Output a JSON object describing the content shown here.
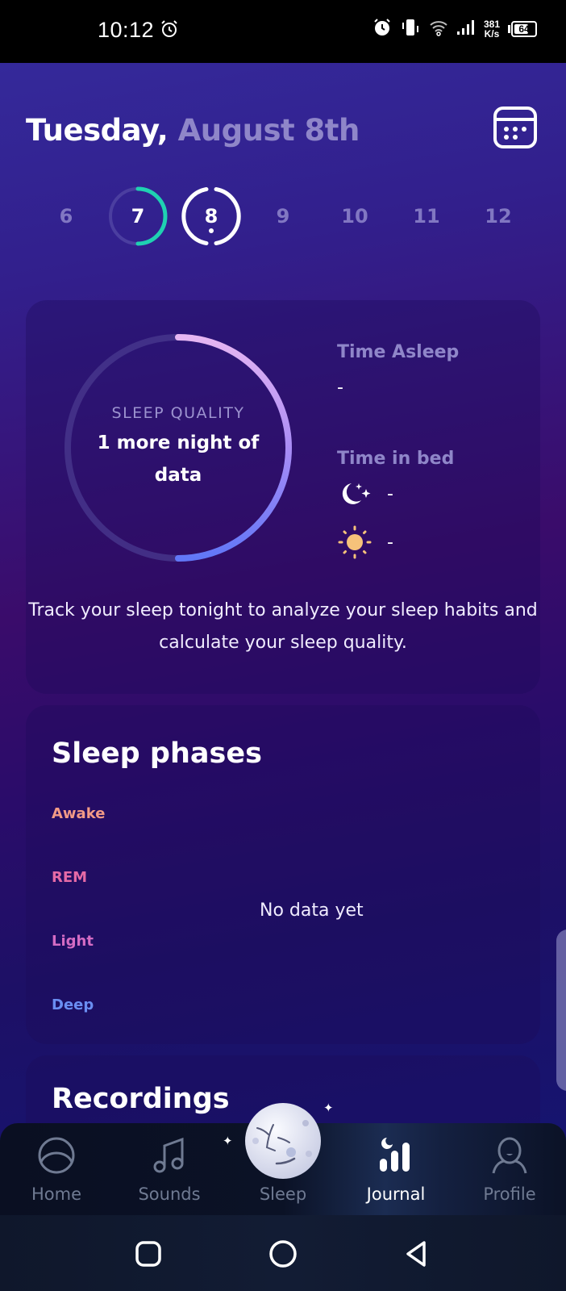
{
  "status_bar": {
    "time": "10:12",
    "network_speed_value": "381",
    "network_speed_unit": "K/s",
    "battery_level": "64",
    "battery_percent": 64,
    "icons": [
      "alarm-icon",
      "alarm-clock-icon",
      "vibrate-icon",
      "wifi-icon",
      "signal-icon",
      "battery-icon"
    ]
  },
  "header": {
    "weekday": "Tuesday,",
    "date": "August 8th",
    "calendar_button": "calendar-icon"
  },
  "day_strip": {
    "days": [
      {
        "label": "6",
        "state": "future-dim"
      },
      {
        "label": "7",
        "state": "done",
        "progress": 0.5
      },
      {
        "label": "8",
        "state": "selected"
      },
      {
        "label": "9",
        "state": "dim"
      },
      {
        "label": "10",
        "state": "dim"
      },
      {
        "label": "11",
        "state": "dim"
      },
      {
        "label": "12",
        "state": "dim"
      }
    ],
    "accent_color": "#1fd1b2"
  },
  "sleep_quality": {
    "label": "SLEEP QUALITY",
    "value": "1 more night of data",
    "progress": 0.5,
    "description": "Track your sleep tonight to analyze your sleep habits and calculate your sleep quality."
  },
  "time_asleep": {
    "title": "Time Asleep",
    "value": "-"
  },
  "time_in_bed": {
    "title": "Time in bed",
    "bedtime": "-",
    "wakeup": "-"
  },
  "sleep_phases": {
    "title": "Sleep phases",
    "phases": [
      {
        "label": "Awake",
        "color": "#f29a86"
      },
      {
        "label": "REM",
        "color": "#e56aa6"
      },
      {
        "label": "Light",
        "color": "#d46cc4"
      },
      {
        "label": "Deep",
        "color": "#6a8ef2"
      }
    ],
    "empty_message": "No data yet"
  },
  "recordings": {
    "title": "Recordings"
  },
  "bottom_nav": {
    "items": [
      {
        "label": "Home",
        "icon": "home-icon",
        "active": false
      },
      {
        "label": "Sounds",
        "icon": "music-note-icon",
        "active": false
      },
      {
        "label": "Sleep",
        "icon": "moon-face-icon",
        "active": false
      },
      {
        "label": "Journal",
        "icon": "journal-chart-icon",
        "active": true
      },
      {
        "label": "Profile",
        "icon": "profile-icon",
        "active": false
      }
    ]
  },
  "system_nav": {
    "buttons": [
      "recents",
      "home",
      "back"
    ]
  }
}
